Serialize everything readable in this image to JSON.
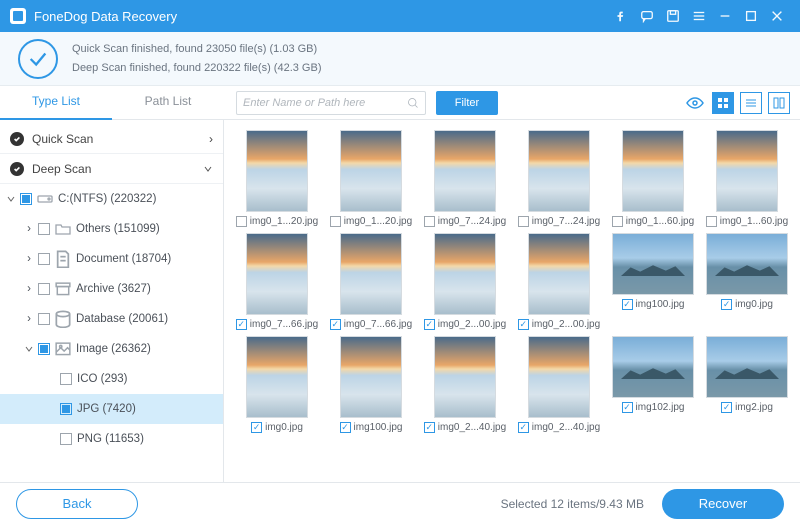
{
  "app": {
    "title": "FoneDog Data Recovery"
  },
  "status": {
    "line1": "Quick Scan finished, found 23050 file(s) (1.03 GB)",
    "line2": "Deep Scan finished, found 220322 file(s) (42.3 GB)"
  },
  "tabs": {
    "type_list": "Type List",
    "path_list": "Path List"
  },
  "search": {
    "placeholder": "Enter Name or Path here"
  },
  "filter_label": "Filter",
  "scan_rows": {
    "quick": "Quick Scan",
    "deep": "Deep Scan"
  },
  "tree": {
    "drive": "C:(NTFS) (220322)",
    "others": "Others (151099)",
    "document": "Document (18704)",
    "archive": "Archive (3627)",
    "database": "Database (20061)",
    "image": "Image (26362)",
    "ico": "ICO (293)",
    "jpg": "JPG (7420)",
    "png": "PNG (11653)"
  },
  "files": [
    {
      "name": "img0_1...20.jpg",
      "checked": false,
      "wide": false
    },
    {
      "name": "img0_1...20.jpg",
      "checked": false,
      "wide": false
    },
    {
      "name": "img0_7...24.jpg",
      "checked": false,
      "wide": false
    },
    {
      "name": "img0_7...24.jpg",
      "checked": false,
      "wide": false
    },
    {
      "name": "img0_1...60.jpg",
      "checked": false,
      "wide": false
    },
    {
      "name": "img0_1...60.jpg",
      "checked": false,
      "wide": false
    },
    {
      "name": "img0_7...66.jpg",
      "checked": true,
      "wide": false
    },
    {
      "name": "img0_7...66.jpg",
      "checked": true,
      "wide": false
    },
    {
      "name": "img0_2...00.jpg",
      "checked": true,
      "wide": false
    },
    {
      "name": "img0_2...00.jpg",
      "checked": true,
      "wide": false
    },
    {
      "name": "img100.jpg",
      "checked": true,
      "wide": true
    },
    {
      "name": "img0.jpg",
      "checked": true,
      "wide": true
    },
    {
      "name": "img0.jpg",
      "checked": true,
      "wide": false
    },
    {
      "name": "img100.jpg",
      "checked": true,
      "wide": false
    },
    {
      "name": "img0_2...40.jpg",
      "checked": true,
      "wide": false
    },
    {
      "name": "img0_2...40.jpg",
      "checked": true,
      "wide": false
    },
    {
      "name": "img102.jpg",
      "checked": true,
      "wide": true
    },
    {
      "name": "img2.jpg",
      "checked": true,
      "wide": true
    }
  ],
  "footer": {
    "back": "Back",
    "recover": "Recover",
    "selected": "Selected 12 items/9.43 MB"
  }
}
